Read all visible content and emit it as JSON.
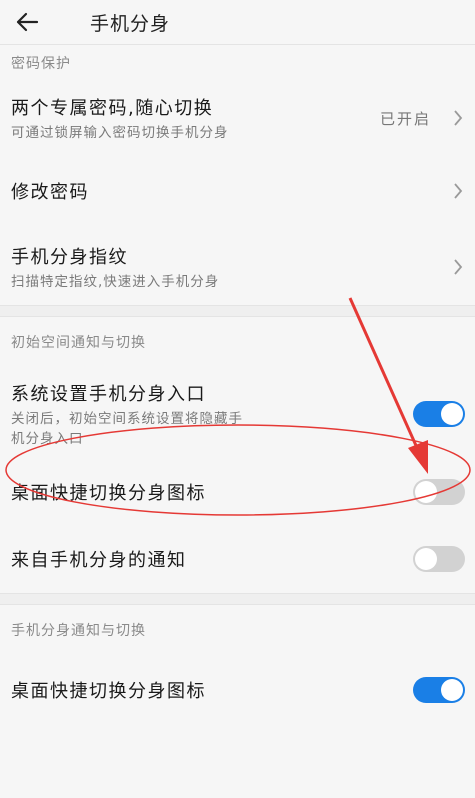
{
  "header": {
    "title": "手机分身"
  },
  "sections": {
    "password": {
      "title": "密码保护",
      "two_passwords": {
        "label": "两个专属密码,随心切换",
        "sub": "可通过锁屏输入密码切换手机分身",
        "value": "已开启"
      },
      "change_password": {
        "label": "修改密码"
      },
      "fingerprint": {
        "label": "手机分身指纹",
        "sub": "扫描特定指纹,快速进入手机分身"
      }
    },
    "initial_space": {
      "title": "初始空间通知与切换",
      "settings_entry": {
        "label": "系统设置手机分身入口",
        "sub1": "关闭后，初始空间系统设置将隐藏手",
        "sub2": "机分身入口",
        "state": true
      },
      "desktop_shortcut": {
        "label": "桌面快捷切换分身图标",
        "state": false
      },
      "notifications": {
        "label": "来自手机分身的通知",
        "state": false
      }
    },
    "clone_space": {
      "title": "手机分身通知与切换",
      "desktop_shortcut": {
        "label": "桌面快捷切换分身图标",
        "state": true
      }
    }
  },
  "colors": {
    "accent": "#1a7fe6",
    "annotation": "#e53935"
  },
  "icons": {
    "back": "arrow-left-icon",
    "chevron": "chevron-right-icon"
  }
}
